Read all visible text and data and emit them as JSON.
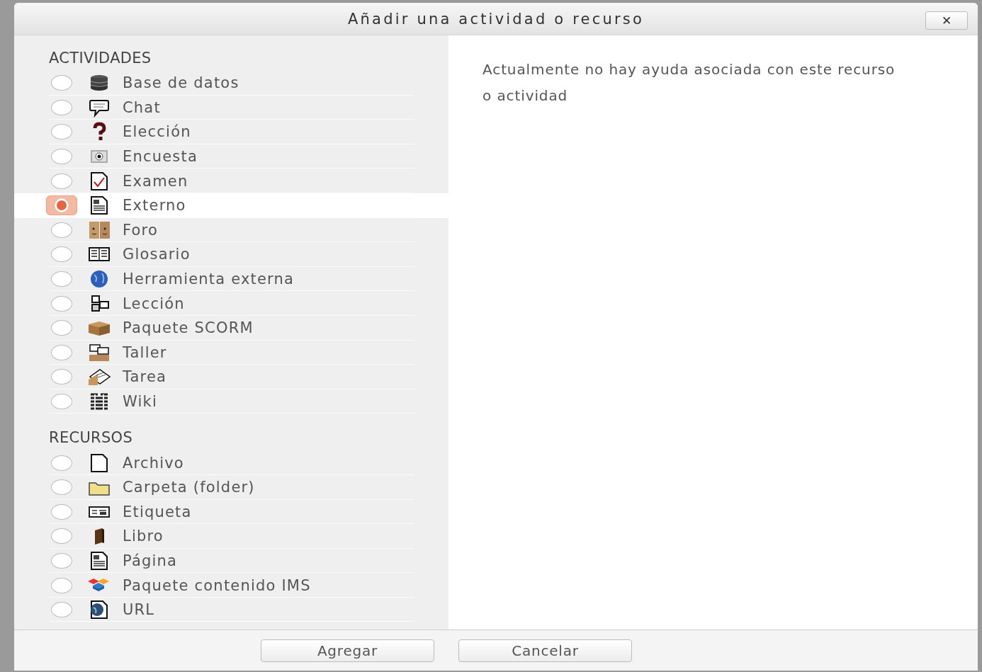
{
  "dialog": {
    "title": "Añadir una actividad o recurso",
    "close": "✕"
  },
  "sections": [
    {
      "heading": "ACTIVIDADES",
      "items": [
        {
          "label": "Base de datos",
          "kind": "database",
          "selected": false
        },
        {
          "label": "Chat",
          "kind": "chat",
          "selected": false
        },
        {
          "label": "Elección",
          "kind": "question",
          "selected": false
        },
        {
          "label": "Encuesta",
          "kind": "survey",
          "selected": false
        },
        {
          "label": "Examen",
          "kind": "quiz",
          "selected": false
        },
        {
          "label": "Externo",
          "kind": "page",
          "selected": true
        },
        {
          "label": "Foro",
          "kind": "forum",
          "selected": false
        },
        {
          "label": "Glosario",
          "kind": "glossary",
          "selected": false
        },
        {
          "label": "Herramienta externa",
          "kind": "globe",
          "selected": false
        },
        {
          "label": "Lección",
          "kind": "lesson",
          "selected": false
        },
        {
          "label": "Paquete SCORM",
          "kind": "package",
          "selected": false
        },
        {
          "label": "Taller",
          "kind": "workshop",
          "selected": false
        },
        {
          "label": "Tarea",
          "kind": "assignment",
          "selected": false
        },
        {
          "label": "Wiki",
          "kind": "wiki",
          "selected": false
        }
      ]
    },
    {
      "heading": "RECURSOS",
      "items": [
        {
          "label": "Archivo",
          "kind": "file",
          "selected": false
        },
        {
          "label": "Carpeta (folder)",
          "kind": "folder",
          "selected": false
        },
        {
          "label": "Etiqueta",
          "kind": "label",
          "selected": false
        },
        {
          "label": "Libro",
          "kind": "book",
          "selected": false
        },
        {
          "label": "Página",
          "kind": "page",
          "selected": false
        },
        {
          "label": "Paquete contenido IMS",
          "kind": "ims",
          "selected": false
        },
        {
          "label": "URL",
          "kind": "url",
          "selected": false
        }
      ]
    }
  ],
  "help": "Actualmente no hay ayuda asociada con este recurso o actividad",
  "buttons": [
    "Agregar",
    "Cancelar"
  ]
}
